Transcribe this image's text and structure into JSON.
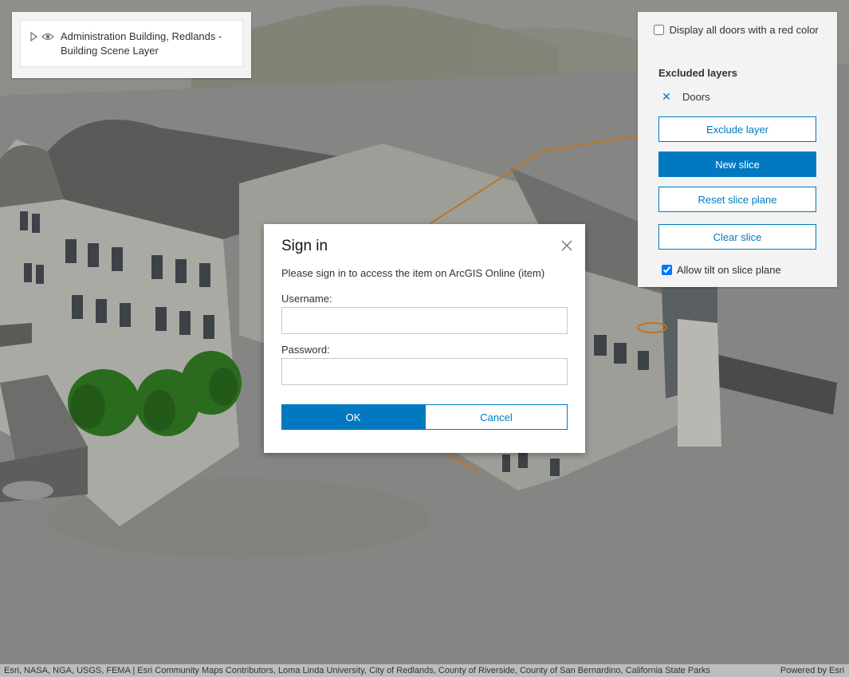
{
  "layer_list": {
    "layer_title": "Administration Building, Redlands - Building Scene Layer"
  },
  "slice_panel": {
    "red_doors_label": "Display all doors with a red color",
    "red_doors_checked": false,
    "excluded_header": "Excluded layers",
    "excluded_items": [
      "Doors"
    ],
    "exclude_layer_button": "Exclude layer",
    "new_slice_button": "New slice",
    "reset_slice_button": "Reset slice plane",
    "clear_slice_button": "Clear slice",
    "allow_tilt_label": "Allow tilt on slice plane",
    "allow_tilt_checked": true
  },
  "sign_in_dialog": {
    "title": "Sign in",
    "message": "Please sign in to access the item on ArcGIS Online (item)",
    "username_label": "Username:",
    "username_value": "",
    "password_label": "Password:",
    "password_value": "",
    "ok_button": "OK",
    "cancel_button": "Cancel"
  },
  "attribution": {
    "text": "Esri, NASA, NGA, USGS, FEMA | Esri Community Maps Contributors, Loma Linda University, City of Redlands, County of Riverside, County of San Bernardino, California State Parks",
    "powered_by": "Powered by Esri"
  },
  "colors": {
    "accent": "#0079c1",
    "slice_plane": "#e8801c",
    "panel_bg": "#f3f3f3"
  }
}
